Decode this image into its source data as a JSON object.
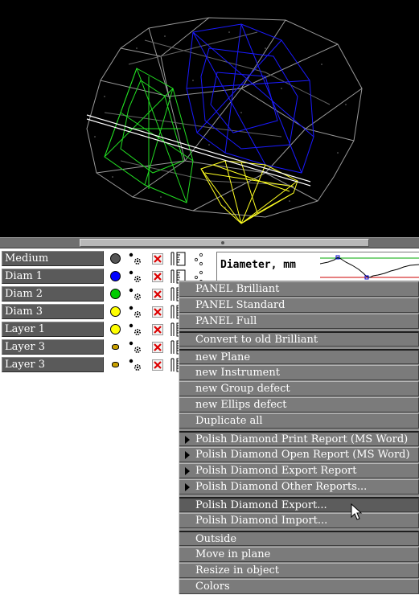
{
  "layers": [
    {
      "name": "Medium",
      "color": "#555555",
      "size": "large"
    },
    {
      "name": "Diam 1",
      "color": "#0000ff",
      "size": "large"
    },
    {
      "name": "Diam 2",
      "color": "#00cc00",
      "size": "large"
    },
    {
      "name": "Diam 3",
      "color": "#ffff00",
      "size": "large"
    },
    {
      "name": "Layer 1",
      "color": "#ffff00",
      "size": "large"
    },
    {
      "name": "Layer 3",
      "color": "#c8a000",
      "size": "small"
    },
    {
      "name": "Layer 3",
      "color": "#c8a000",
      "size": "small"
    }
  ],
  "graph": {
    "label": "Diameter, mm"
  },
  "context_menu": {
    "items": [
      {
        "label": "PANEL Brilliant",
        "submenu": false,
        "highlighted": false,
        "separator_before": false
      },
      {
        "label": "PANEL Standard",
        "submenu": false,
        "highlighted": false,
        "separator_before": false
      },
      {
        "label": "PANEL Full",
        "submenu": false,
        "highlighted": false,
        "separator_before": false
      },
      {
        "label": "Convert to old Brilliant",
        "submenu": false,
        "highlighted": false,
        "separator_before": true
      },
      {
        "label": "new Plane",
        "submenu": false,
        "highlighted": false,
        "separator_before": true
      },
      {
        "label": "new Instrument",
        "submenu": false,
        "highlighted": false,
        "separator_before": false
      },
      {
        "label": "new Group defect",
        "submenu": false,
        "highlighted": false,
        "separator_before": false
      },
      {
        "label": "new Ellips defect",
        "submenu": false,
        "highlighted": false,
        "separator_before": false
      },
      {
        "label": "Duplicate all",
        "submenu": false,
        "highlighted": false,
        "separator_before": false
      },
      {
        "label": "Polish Diamond Print Report (MS Word)",
        "submenu": true,
        "highlighted": false,
        "separator_before": true
      },
      {
        "label": "Polish Diamond Open Report (MS Word)",
        "submenu": true,
        "highlighted": false,
        "separator_before": false
      },
      {
        "label": "Polish Diamond Export Report",
        "submenu": true,
        "highlighted": false,
        "separator_before": false
      },
      {
        "label": "Polish Diamond Other Reports...",
        "submenu": true,
        "highlighted": false,
        "separator_before": false
      },
      {
        "label": "Polish Diamond Export...",
        "submenu": false,
        "highlighted": true,
        "separator_before": true
      },
      {
        "label": "Polish Diamond Import...",
        "submenu": false,
        "highlighted": false,
        "separator_before": false
      },
      {
        "label": "Outside",
        "submenu": false,
        "highlighted": false,
        "separator_before": true
      },
      {
        "label": "Move in plane",
        "submenu": false,
        "highlighted": false,
        "separator_before": false
      },
      {
        "label": "Resize in object",
        "submenu": false,
        "highlighted": false,
        "separator_before": false
      },
      {
        "label": "Colors",
        "submenu": false,
        "highlighted": false,
        "separator_before": false
      }
    ]
  },
  "icons": {
    "layer_row": [
      "color-swatch-icon",
      "gear-icon",
      "delete-icon",
      "ruler-icon",
      "dots-icon"
    ],
    "cursor": "mouse-pointer-icon"
  }
}
